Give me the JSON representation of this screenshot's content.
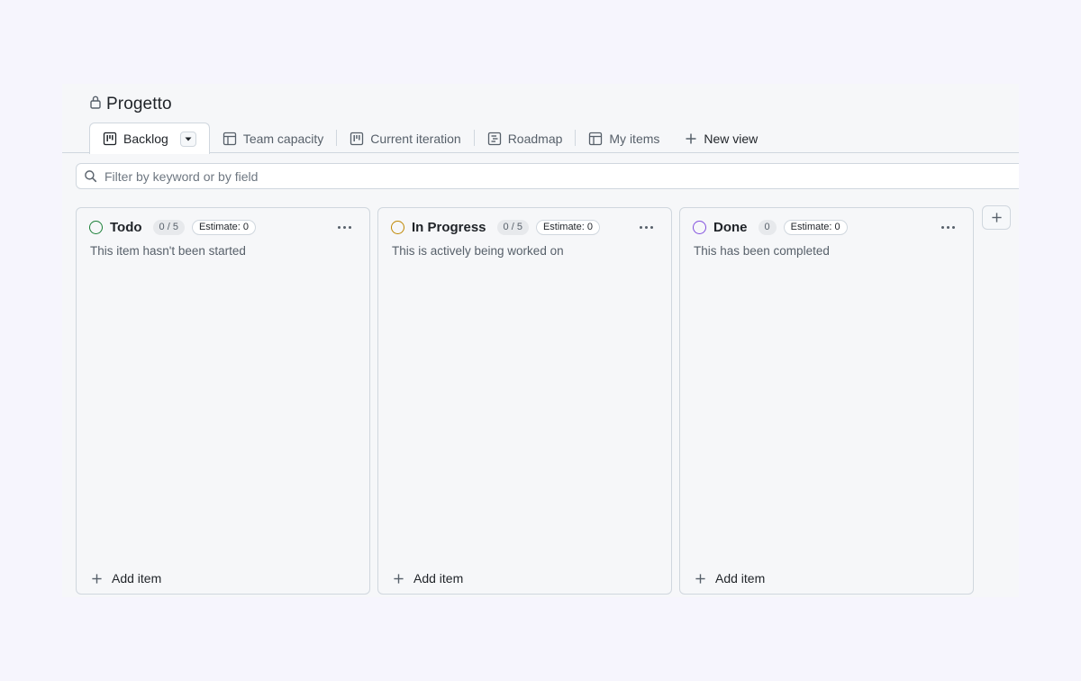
{
  "project": {
    "title": "Progetto",
    "lock_icon": "lock-icon"
  },
  "tabs": [
    {
      "label": "Backlog",
      "icon": "board-icon",
      "active": true
    },
    {
      "label": "Team capacity",
      "icon": "table-icon"
    },
    {
      "label": "Current iteration",
      "icon": "board-icon"
    },
    {
      "label": "Roadmap",
      "icon": "roadmap-icon"
    },
    {
      "label": "My items",
      "icon": "table-icon"
    }
  ],
  "new_view_label": "New view",
  "filter": {
    "placeholder": "Filter by keyword or by field",
    "value": ""
  },
  "columns": [
    {
      "name": "Todo",
      "count": "0 / 5",
      "estimate": "Estimate: 0",
      "description": "This item hasn't been started",
      "color": "#1a7f37",
      "add_label": "Add item"
    },
    {
      "name": "In Progress",
      "count": "0 / 5",
      "estimate": "Estimate: 0",
      "description": "This is actively being worked on",
      "color": "#bf8700",
      "add_label": "Add item"
    },
    {
      "name": "Done",
      "count": "0",
      "estimate": "Estimate: 0",
      "description": "This has been completed",
      "color": "#8250df",
      "add_label": "Add item"
    }
  ]
}
